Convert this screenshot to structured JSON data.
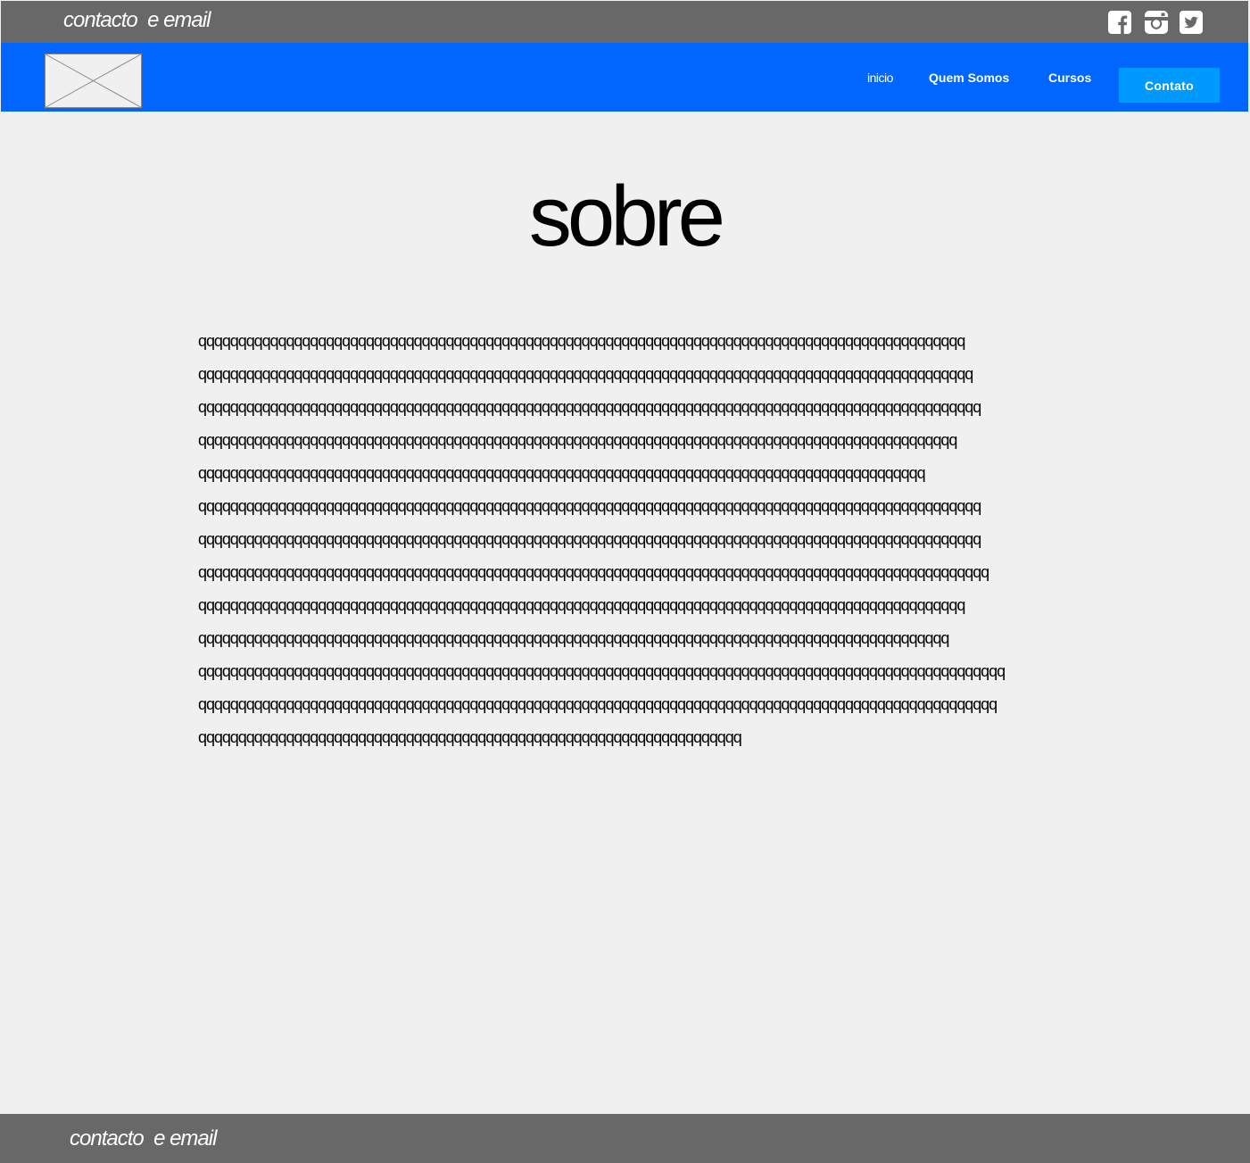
{
  "topbar": {
    "contact_text": "contacto  e email",
    "social": [
      {
        "icon": "facebook-icon"
      },
      {
        "icon": "instagram-icon"
      },
      {
        "icon": "twitter-icon"
      }
    ]
  },
  "navbar": {
    "logo_icon": "image-placeholder-icon",
    "items": [
      {
        "label": "inicio"
      },
      {
        "label": "Quem Somos"
      },
      {
        "label": "Cursos"
      }
    ],
    "cta_label": "Contato"
  },
  "main": {
    "title": "sobre",
    "lines": [
      "qqqqqqqqqqqqqqqqqqqqqqqqqqqqqqqqqqqqqqqqqqqqqqqqqqqqqqqqqqqqqqqqqqqqqqqqqqqqqqqqqqqqqqqqqqqqqqqq",
      "qqqqqqqqqqqqqqqqqqqqqqqqqqqqqqqqqqqqqqqqqqqqqqqqqqqqqqqqqqqqqqqqqqqqqqqqqqqqqqqqqqqqqqqqqqqqqqqqq",
      "qqqqqqqqqqqqqqqqqqqqqqqqqqqqqqqqqqqqqqqqqqqqqqqqqqqqqqqqqqqqqqqqqqqqqqqqqqqqqqqqqqqqqqqqqqqqqqqqqq",
      "qqqqqqqqqqqqqqqqqqqqqqqqqqqqqqqqqqqqqqqqqqqqqqqqqqqqqqqqqqqqqqqqqqqqqqqqqqqqqqqqqqqqqqqqqqqqqqq",
      "qqqqqqqqqqqqqqqqqqqqqqqqqqqqqqqqqqqqqqqqqqqqqqqqqqqqqqqqqqqqqqqqqqqqqqqqqqqqqqqqqqqqqqqqqqq",
      "qqqqqqqqqqqqqqqqqqqqqqqqqqqqqqqqqqqqqqqqqqqqqqqqqqqqqqqqqqqqqqqqqqqqqqqqqqqqqqqqqqqqqqqqqqqqqqqqqq",
      "qqqqqqqqqqqqqqqqqqqqqqqqqqqqqqqqqqqqqqqqqqqqqqqqqqqqqqqqqqqqqqqqqqqqqqqqqqqqqqqqqqqqqqqqqqqqqqqqqq",
      "qqqqqqqqqqqqqqqqqqqqqqqqqqqqqqqqqqqqqqqqqqqqqqqqqqqqqqqqqqqqqqqqqqqqqqqqqqqqqqqqqqqqqqqqqqqqqqqqqqq",
      "qqqqqqqqqqqqqqqqqqqqqqqqqqqqqqqqqqqqqqqqqqqqqqqqqqqqqqqqqqqqqqqqqqqqqqqqqqqqqqqqqqqqqqqqqqqqqqqq",
      "qqqqqqqqqqqqqqqqqqqqqqqqqqqqqqqqqqqqqqqqqqqqqqqqqqqqqqqqqqqqqqqqqqqqqqqqqqqqqqqqqqqqqqqqqqqqqq",
      "qqqqqqqqqqqqqqqqqqqqqqqqqqqqqqqqqqqqqqqqqqqqqqqqqqqqqqqqqqqqqqqqqqqqqqqqqqqqqqqqqqqqqqqqqqqqqqqqqqqqq",
      "qqqqqqqqqqqqqqqqqqqqqqqqqqqqqqqqqqqqqqqqqqqqqqqqqqqqqqqqqqqqqqqqqqqqqqqqqqqqqqqqqqqqqqqqqqqqqqqqqqqq",
      "qqqqqqqqqqqqqqqqqqqqqqqqqqqqqqqqqqqqqqqqqqqqqqqqqqqqqqqqqqqqqqqqqqqq"
    ]
  },
  "footer": {
    "contact_text": "contacto  e email"
  },
  "colors": {
    "topbar_bg": "#686868",
    "navbar_bg": "#0066ff",
    "cta_bg": "#0099ff",
    "page_bg": "#f0f0f0",
    "text": "#000000"
  }
}
